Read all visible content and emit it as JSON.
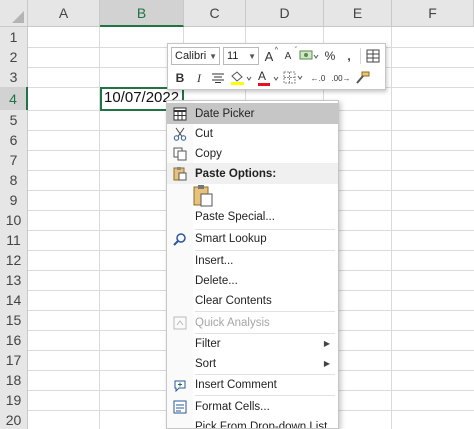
{
  "spreadsheet": {
    "columns": [
      "A",
      "B",
      "C",
      "D",
      "E",
      "F"
    ],
    "active_column": "B",
    "rows": [
      "1",
      "2",
      "3",
      "4",
      "5",
      "6",
      "7",
      "8",
      "9",
      "10",
      "11",
      "12",
      "13",
      "14",
      "15",
      "16",
      "17",
      "18",
      "19",
      "20"
    ],
    "active_row": "4",
    "selected_cell": {
      "address": "B4",
      "value": "10/07/2022"
    }
  },
  "mini_toolbar": {
    "font_name": "Calibri",
    "font_size": "11",
    "grow_font": "A",
    "shrink_font": "A",
    "percent": "%",
    "comma": ",",
    "bold": "B",
    "italic": "I",
    "font_color_letter": "A",
    "increase_decimal": "←.0",
    "decrease_decimal": ".00→"
  },
  "context_menu": {
    "items": [
      {
        "label": "Date Picker",
        "icon": "calendar-grid-icon"
      },
      {
        "label": "Cut",
        "icon": "scissors-icon"
      },
      {
        "label": "Copy",
        "icon": "copy-icon"
      },
      {
        "label": "Paste Options:",
        "icon": "paste-icon"
      },
      {
        "label": "Paste Special...",
        "icon": ""
      },
      {
        "label": "Smart Lookup",
        "icon": "search-icon"
      },
      {
        "label": "Insert...",
        "icon": ""
      },
      {
        "label": "Delete...",
        "icon": ""
      },
      {
        "label": "Clear Contents",
        "icon": ""
      },
      {
        "label": "Quick Analysis",
        "icon": "quick-analysis-icon"
      },
      {
        "label": "Filter",
        "icon": ""
      },
      {
        "label": "Sort",
        "icon": ""
      },
      {
        "label": "Insert Comment",
        "icon": "comment-icon"
      },
      {
        "label": "Format Cells...",
        "icon": "format-cells-icon"
      },
      {
        "label": "Pick From Drop-down List...",
        "icon": ""
      }
    ]
  },
  "colors": {
    "accent": "#217346",
    "menu_highlight": "#c6c6c6",
    "font_color": "#e81123",
    "highlight_color": "#ffff00",
    "disabled_text": "#a6a6a6"
  }
}
